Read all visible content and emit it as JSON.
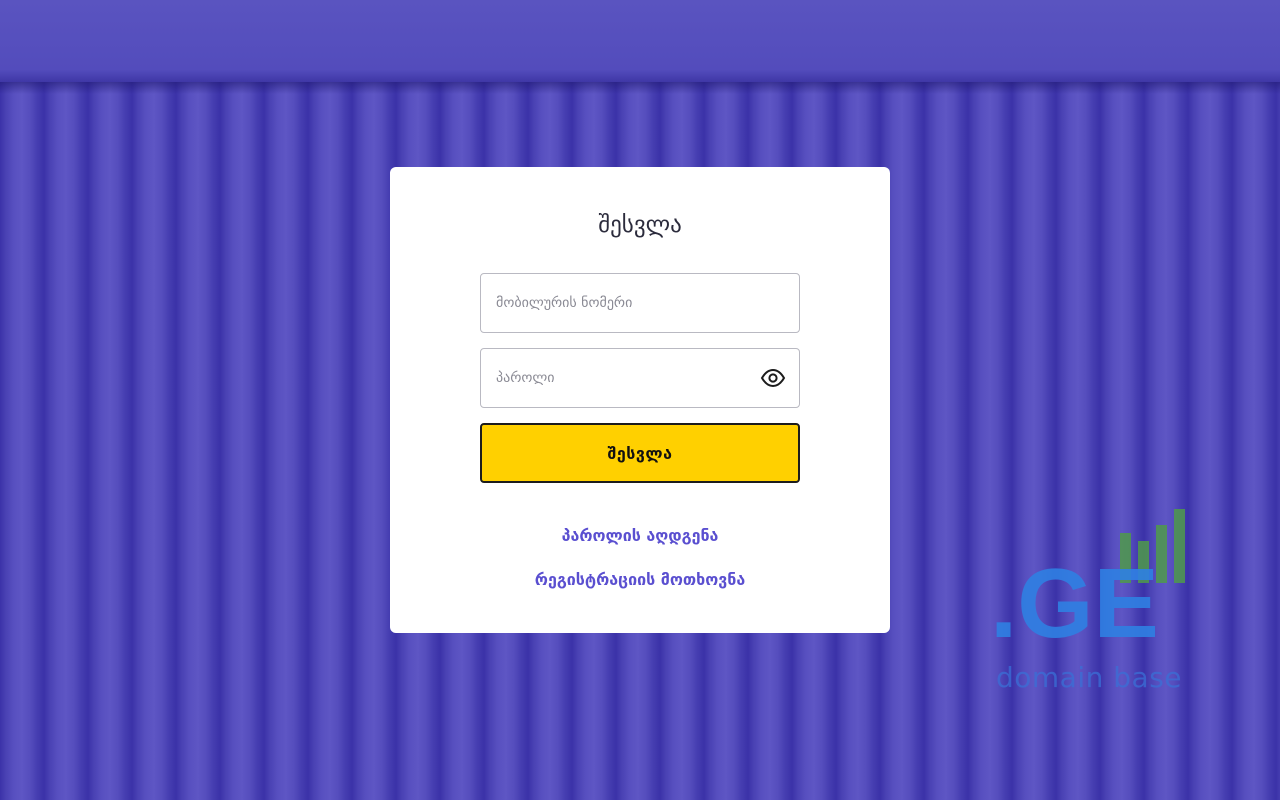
{
  "login": {
    "title": "შესვლა",
    "phone": {
      "placeholder": "მობილურის ნომერი",
      "value": ""
    },
    "password": {
      "placeholder": "პაროლი",
      "value": "",
      "toggle_icon": "eye-icon"
    },
    "submit_label": "შესვლა",
    "forgot_password_label": "პაროლის აღდგენა",
    "register_label": "რეგისტრაციის მოთხოვნა"
  },
  "watermark": {
    "logo_text": ".GE",
    "caption": "domain base"
  },
  "colors": {
    "background": "#5149b8",
    "card": "#ffffff",
    "button": "#ffd000",
    "link": "#5a4fd0",
    "watermark_blue": "#2f80e3",
    "watermark_green": "#4f9a4a"
  }
}
